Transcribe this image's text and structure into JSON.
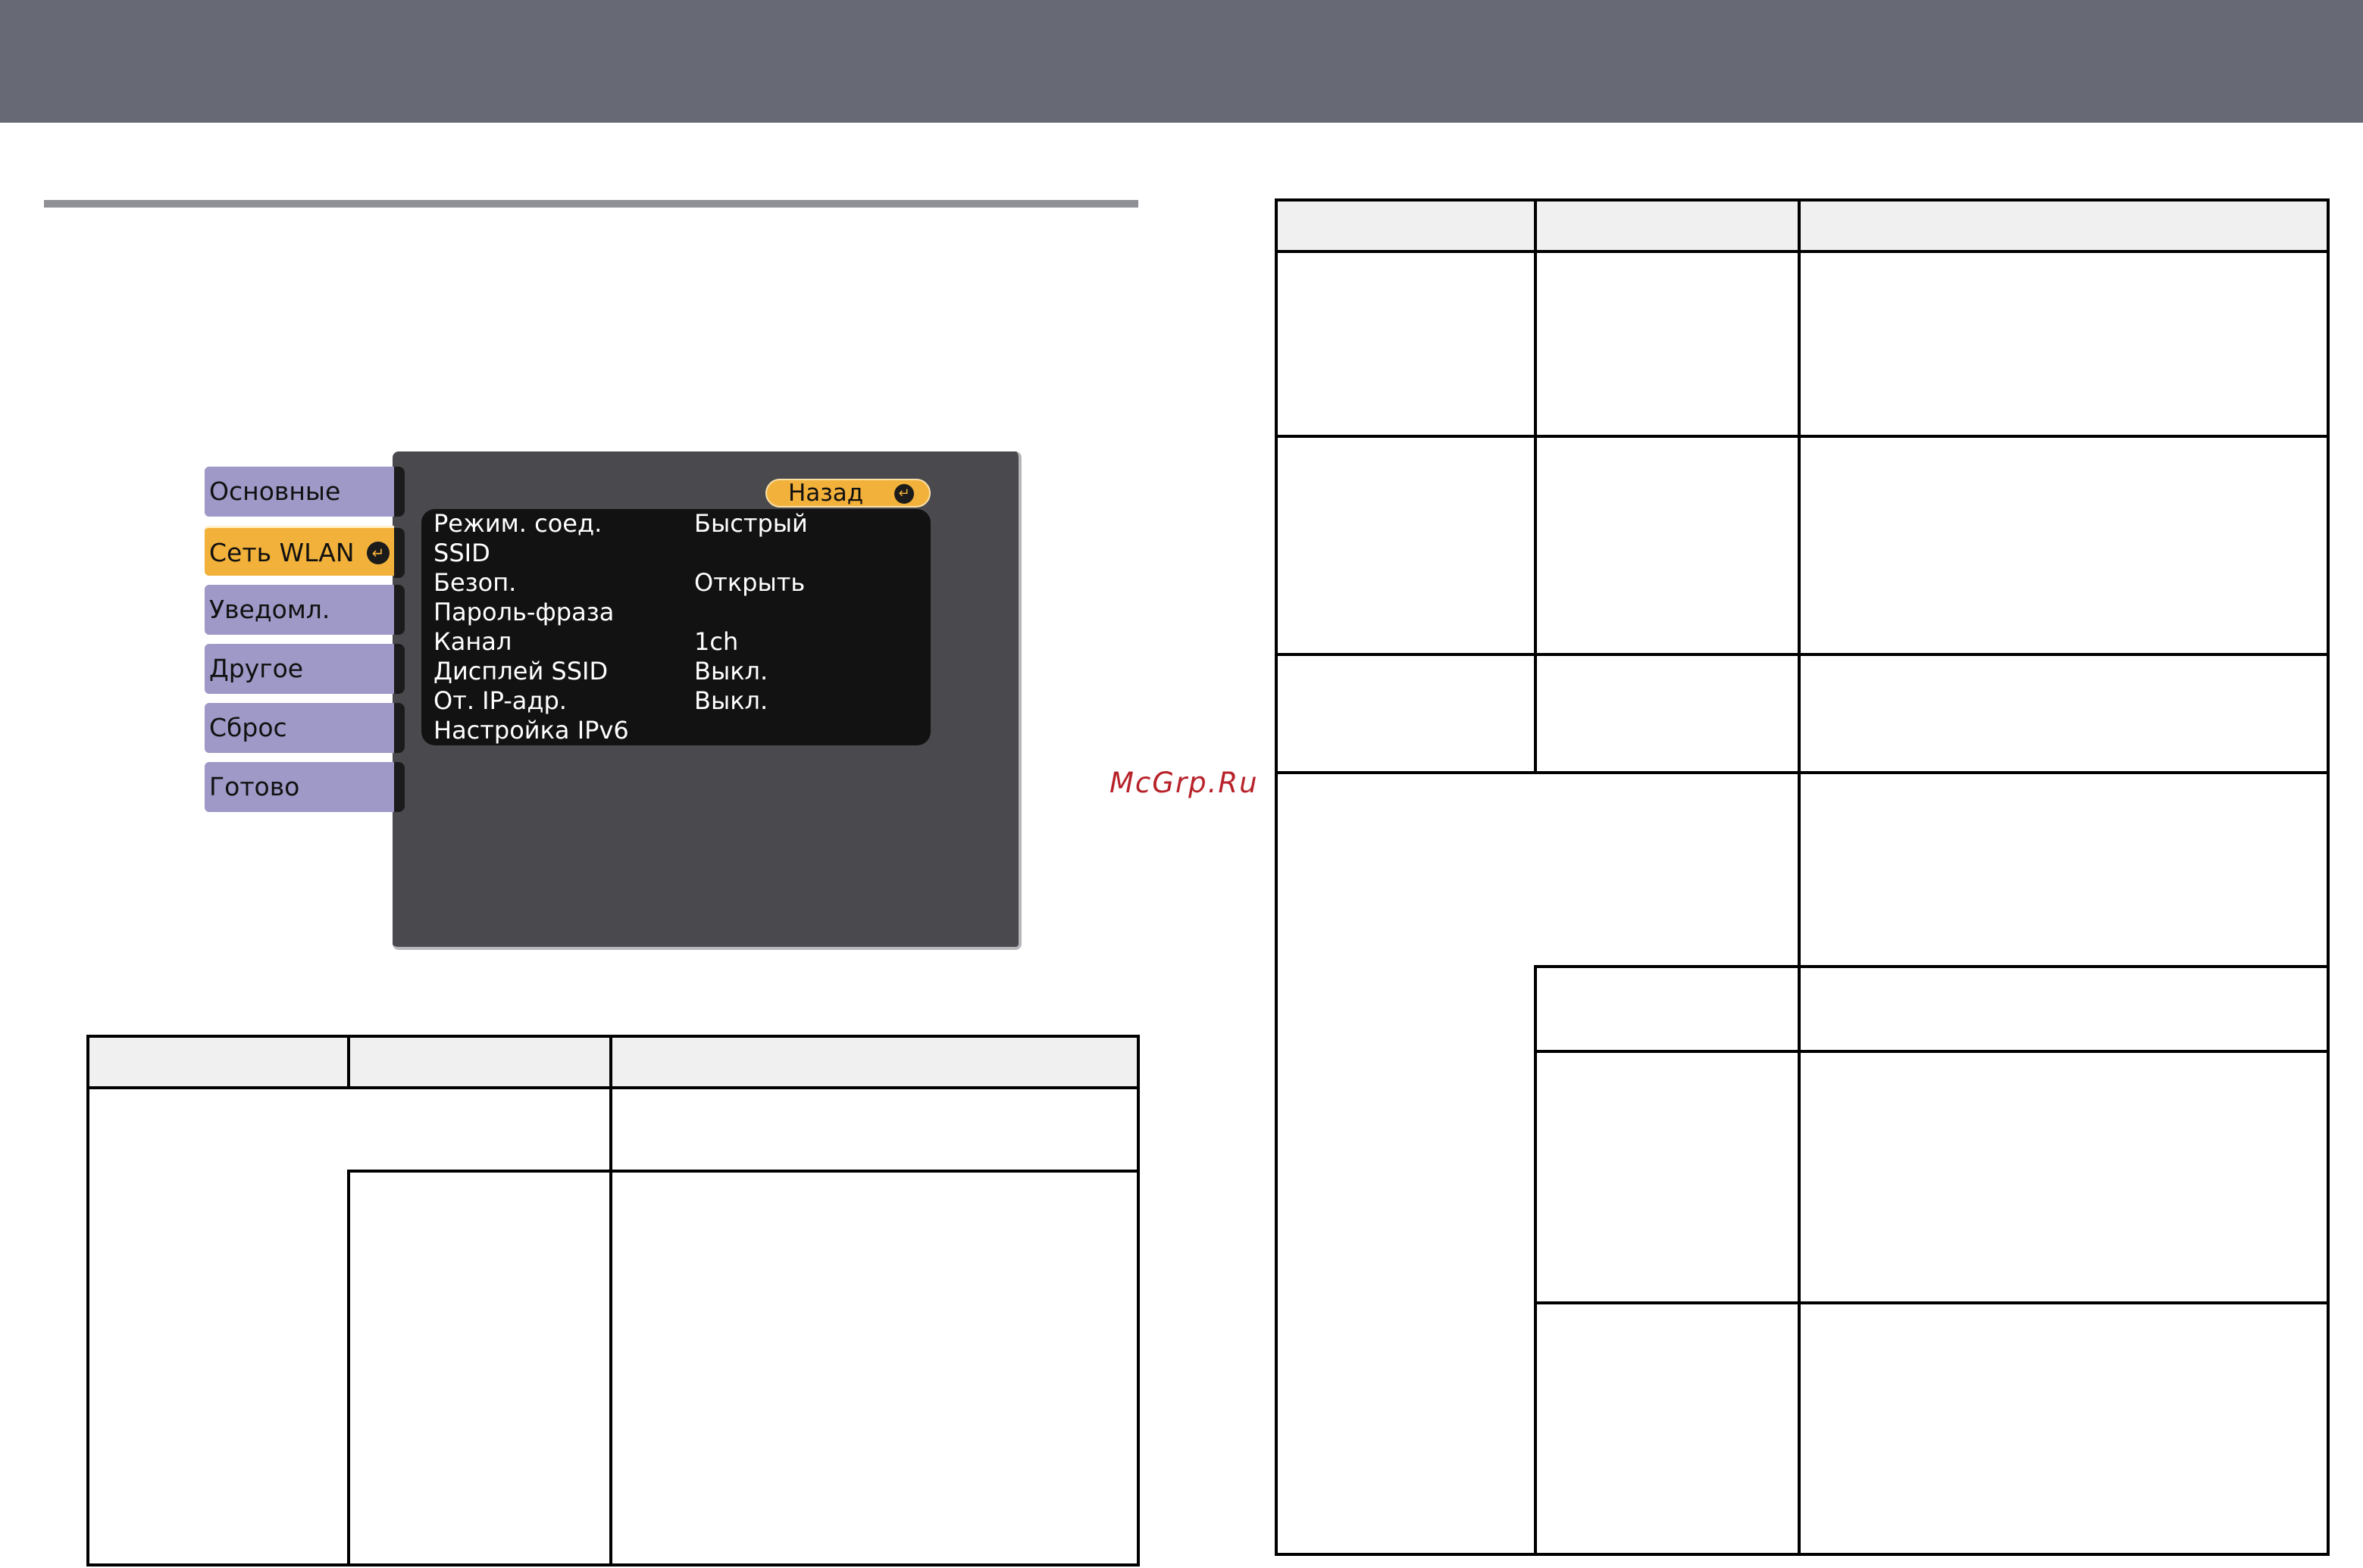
{
  "menu": {
    "tabs": [
      {
        "label": "Основные",
        "active": false
      },
      {
        "label": "Сеть WLAN",
        "active": true
      },
      {
        "label": "Уведомл.",
        "active": false
      },
      {
        "label": "Другое",
        "active": false
      },
      {
        "label": "Сброс",
        "active": false
      },
      {
        "label": "Готово",
        "active": false
      }
    ],
    "back_label": "Назад",
    "settings": [
      {
        "name": "Режим. соед.",
        "value": "Быстрый"
      },
      {
        "name": "SSID",
        "value": ""
      },
      {
        "name": "Безоп.",
        "value": "Открыть"
      },
      {
        "name": "Пароль-фраза",
        "value": ""
      },
      {
        "name": "Канал",
        "value": "1ch"
      },
      {
        "name": "Дисплей SSID",
        "value": "Выкл."
      },
      {
        "name": "От. IP-адр.",
        "value": "Выкл."
      },
      {
        "name": "Настройка IPv6",
        "value": ""
      }
    ],
    "colors": {
      "accent": "#f2b13a",
      "tab": "#9e99c6",
      "panel": "#4a4a4e",
      "list": "#121212"
    }
  },
  "watermark": "McGrp.Ru"
}
